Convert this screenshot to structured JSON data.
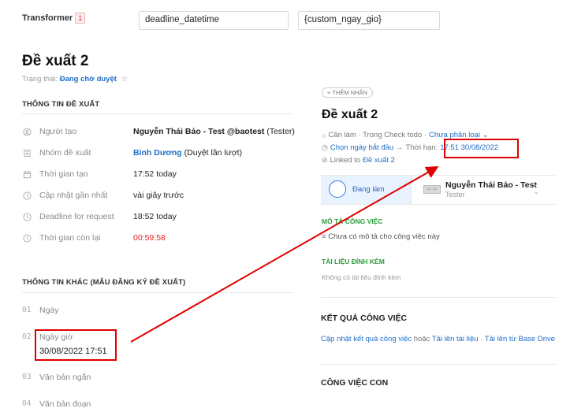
{
  "transformer": {
    "label": "Transformer",
    "badge": "1",
    "field_input": "deadline_datetime",
    "value_input": "{custom_ngay_gio}"
  },
  "proposal": {
    "title": "Đề xuất 2",
    "status_label": "Trạng thái:",
    "status_value": "Đang chờ duyệt",
    "star": "☆"
  },
  "info_section": {
    "title": "THÔNG TIN ĐỀ XUẤT",
    "rows": [
      {
        "icon": "user-icon",
        "label": "Người tạo",
        "value_bold": "Nguyễn Thái Bảo - Test @baotest",
        "value_rest": " (Tester)"
      },
      {
        "icon": "group-icon",
        "label": "Nhóm đề xuất",
        "value_link": "Bình Dương",
        "value_rest": " (Duyệt lần lượt)"
      },
      {
        "icon": "calendar-icon",
        "label": "Thời gian tạo",
        "value": "17:52 today"
      },
      {
        "icon": "clock-icon",
        "label": "Cập nhật gần nhất",
        "value": "vài giây trước"
      },
      {
        "icon": "clock-icon",
        "label": "Deadline for request",
        "value": "18:52 today"
      },
      {
        "icon": "clock-icon",
        "label": "Thời gian còn lại",
        "value": "00:59:58"
      }
    ]
  },
  "other_section": {
    "title": "THÔNG TIN KHÁC (MẪU ĐĂNG KÝ ĐỀ XUẤT)",
    "fields": [
      {
        "num": "01",
        "label": "Ngày"
      },
      {
        "num": "02",
        "label": "Ngày giờ",
        "value": "30/08/2022 17:51"
      },
      {
        "num": "03",
        "label": "Văn bản ngắn"
      },
      {
        "num": "04",
        "label": "Văn bản đoạn"
      }
    ]
  },
  "task": {
    "add_tag": "+ THÊM NHÃN",
    "title": "Đề xuất 2",
    "meta1_prefix": "Cần làm · Trong Check todo ·",
    "meta1_link": "Chưa phân loại ⌄",
    "meta2_link": "Chọn ngày bắt đầu",
    "meta2_arrow": "→",
    "meta2_label": "Thời hạn:",
    "meta2_deadline": "17:51 30/08/2022",
    "meta3_prefix": "Linked to",
    "meta3_link": "Đề xuất 2",
    "status": "Đang làm",
    "assignee_name": "Nguyễn Thái Bảo - Test",
    "assignee_role": "Tester",
    "desc_title": "MÔ TẢ CÔNG VIỆC",
    "desc_text": "Chưa có mô tả cho công việc này",
    "attach_title": "TÀI LIỆU ĐÍNH KÈM",
    "attach_text": "Không có tài liệu đính kèm",
    "result_title": "KẾT QUẢ CÔNG VIỆC",
    "result_link1": "Cập nhật kết quả công việc",
    "result_or": " hoặc ",
    "result_link2": "Tải lên tài liệu",
    "result_sep": " · ",
    "result_link3": "Tải lên từ Base Drive",
    "subtasks_title": "CÔNG VIỆC CON"
  },
  "colors": {
    "accent": "#1e6ec8",
    "annotation_red": "#e00000",
    "green": "#2e9c3f"
  }
}
